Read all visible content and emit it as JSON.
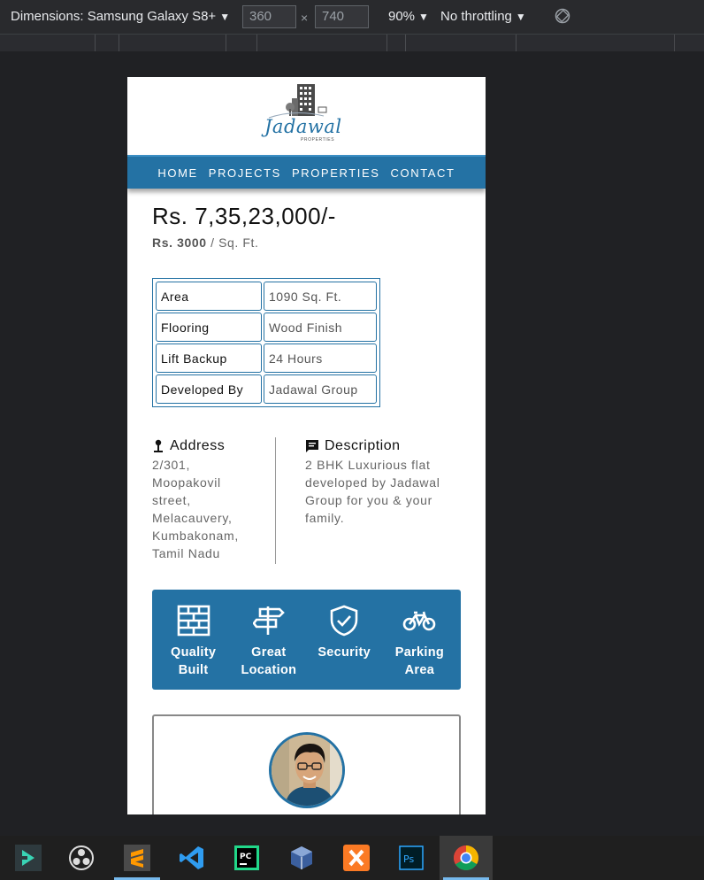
{
  "devtools": {
    "device_label": "Dimensions: Samsung Galaxy S8+",
    "width": "360",
    "height": "740",
    "zoom": "90%",
    "throttling": "No throttling",
    "dropdown_glyph": "▼",
    "times_glyph": "×"
  },
  "site": {
    "logo_text": "Jadawal",
    "logo_sub": "PROPERTIES",
    "nav": [
      "HOME",
      "PROJECTS",
      "PROPERTIES",
      "CONTACT"
    ]
  },
  "listing": {
    "price": "Rs. 7,35,23,000/-",
    "rate_value": "Rs. 3000",
    "rate_unit": "/ Sq. Ft.",
    "specs": [
      {
        "key": "Area",
        "value": "1090 Sq. Ft."
      },
      {
        "key": "Flooring",
        "value": "Wood Finish"
      },
      {
        "key": "Lift Backup",
        "value": "24 Hours"
      },
      {
        "key": "Developed By",
        "value": "Jadawal Group"
      }
    ],
    "address_title": "Address",
    "address_lines": [
      "2/301,",
      "Moopakovil",
      "street,",
      "Melacauvery,",
      "Kumbakonam,",
      "Tamil Nadu"
    ],
    "description_title": "Description",
    "description_lines": [
      "2 BHK Luxurious flat",
      "developed by Jadawal",
      "Group for you & your",
      "family."
    ],
    "features": [
      {
        "l1": "Quality",
        "l2": "Built",
        "icon": "brick-wall-icon"
      },
      {
        "l1": "Great",
        "l2": "Location",
        "icon": "signpost-icon"
      },
      {
        "l1": "Security",
        "l2": "",
        "icon": "shield-check-icon"
      },
      {
        "l1": "Parking",
        "l2": "Area",
        "icon": "bicycle-icon"
      }
    ]
  },
  "taskbar": {
    "apps": [
      "filmora-icon",
      "obs-icon",
      "sublime-text-icon",
      "vscode-icon",
      "pycharm-icon",
      "virtualbox-icon",
      "xampp-icon",
      "photoshop-icon",
      "chrome-icon"
    ],
    "active": "chrome-icon"
  },
  "colors": {
    "brand_blue": "#2472a4",
    "devtools_bg": "#292a2d",
    "page_bg": "#202124"
  }
}
